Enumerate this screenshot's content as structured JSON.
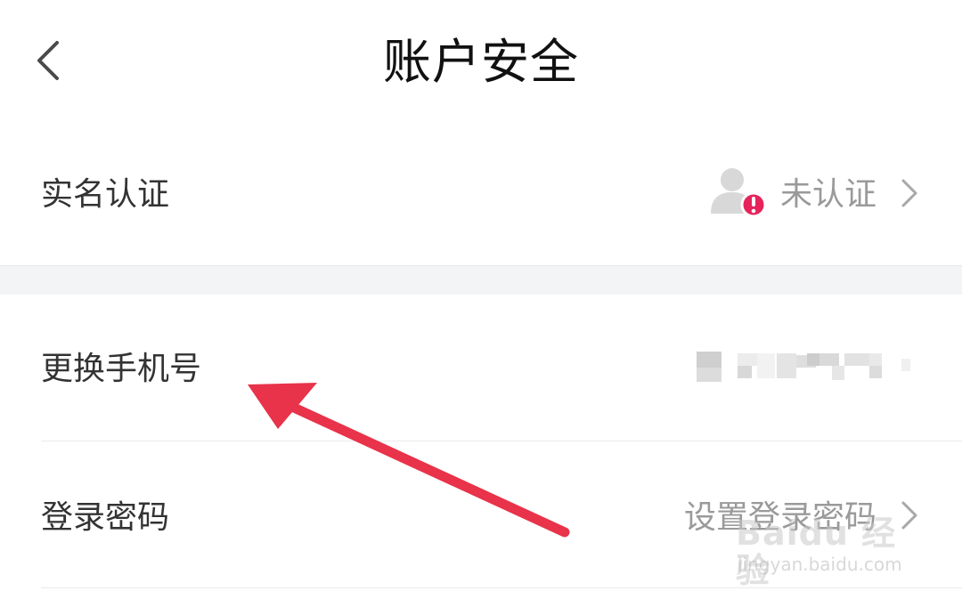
{
  "header": {
    "title": "账户安全",
    "back_icon": "chevron-left-icon"
  },
  "rows": [
    {
      "label": "实名认证",
      "value": "未认证",
      "status_icon": "user-alert-icon",
      "status_color": "#e5245c",
      "chevron": true
    },
    {
      "label": "更换手机号",
      "value_obscured": true
    },
    {
      "label": "登录密码",
      "value": "设置登录密码",
      "chevron": true
    }
  ],
  "watermark": {
    "brand": "Baidu 经验",
    "url": "jingyan.baidu.com"
  },
  "annotation": {
    "arrow_color": "#e8334a"
  }
}
